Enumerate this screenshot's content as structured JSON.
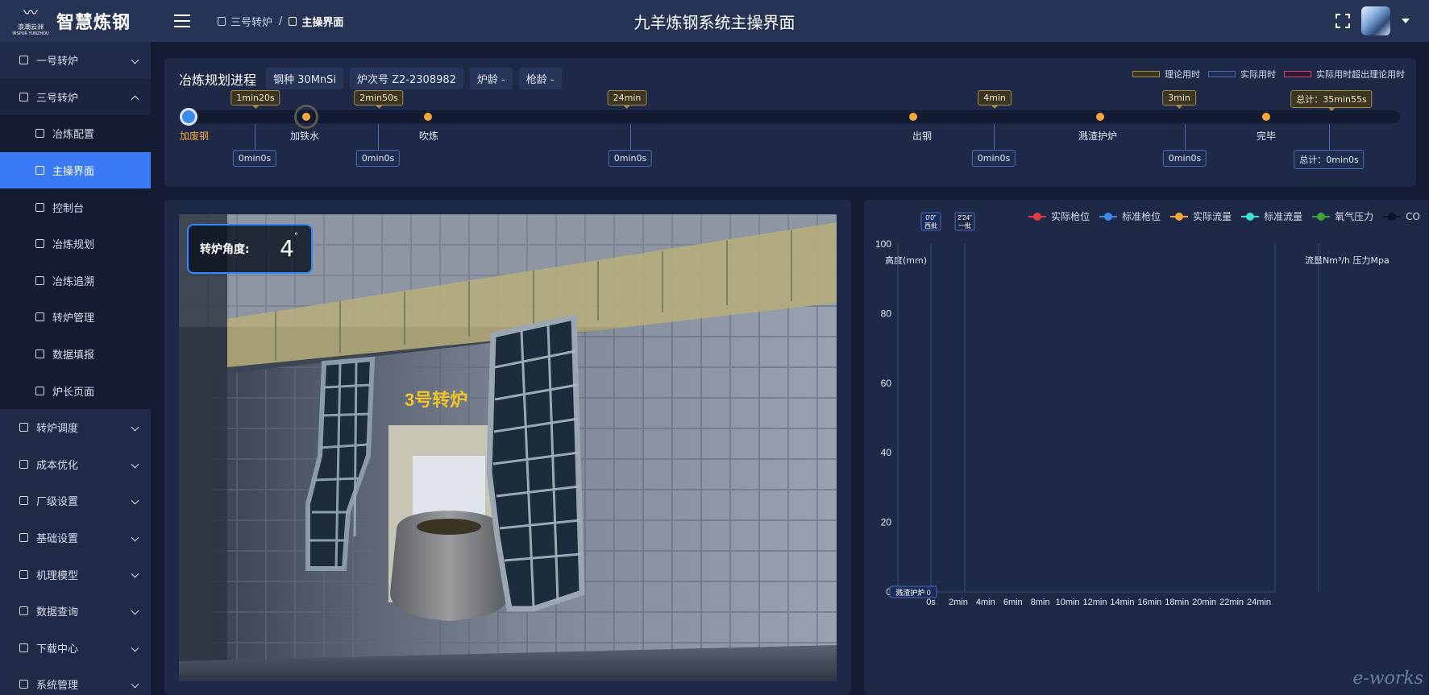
{
  "header": {
    "brand_mark": "浪潮云洲",
    "brand_sub": "INSPUR YUNZHOU",
    "app_title": "智慧炼钢",
    "page_title": "九羊炼钢系统主操界面",
    "breadcrumb": [
      "三号转炉",
      "主操界面"
    ]
  },
  "sidebar": {
    "items": [
      {
        "label": "一号转炉",
        "open": false
      },
      {
        "label": "三号转炉",
        "open": true
      },
      {
        "label": "冶炼配置"
      },
      {
        "label": "主操界面",
        "active": true
      },
      {
        "label": "控制台"
      },
      {
        "label": "冶炼规划"
      },
      {
        "label": "冶炼追溯"
      },
      {
        "label": "转炉管理"
      },
      {
        "label": "数据填报"
      },
      {
        "label": "炉长页面"
      },
      {
        "label": "转炉调度",
        "open": false
      },
      {
        "label": "成本优化",
        "open": false
      },
      {
        "label": "厂级设置",
        "open": false
      },
      {
        "label": "基础设置",
        "open": false
      },
      {
        "label": "机理模型",
        "open": false
      },
      {
        "label": "数据查询",
        "open": false
      },
      {
        "label": "下载中心",
        "open": false
      },
      {
        "label": "系统管理",
        "open": false
      }
    ]
  },
  "progress": {
    "title": "冶炼规划进程",
    "tags": [
      "钢种 30MnSi",
      "炉次号 Z2-2308982",
      "炉龄 -",
      "枪龄 -"
    ],
    "legend": [
      {
        "label": "理论用时",
        "color": "#3b3623",
        "border": "#a58b43"
      },
      {
        "label": "实际用时",
        "color": "#1f2d50",
        "border": "#4c6ab4"
      },
      {
        "label": "实际用时超出理论用时",
        "color": "#2a1d33",
        "border": "#d9406b"
      }
    ],
    "stages": [
      "加废钢",
      "加铁水",
      "吹炼",
      "出钢",
      "溅渣护炉",
      "完毕"
    ],
    "theory_times": [
      "1min20s",
      "2min50s",
      "24min",
      "4min",
      "3min",
      "总计：35min55s"
    ],
    "actual_times": [
      "0min0s",
      "0min0s",
      "0min0s",
      "0min0s",
      "0min0s",
      "总计：0min0s"
    ]
  },
  "scene": {
    "angle_label": "转炉角度:",
    "angle_value": "4",
    "angle_unit": "°",
    "furnace_label": "3号转炉"
  },
  "chart_data": {
    "type": "line",
    "legend": [
      {
        "name": "实际枪位",
        "color": "#e23b3b"
      },
      {
        "name": "标准枪位",
        "color": "#3d8bf0"
      },
      {
        "name": "实际流量",
        "color": "#f5a838"
      },
      {
        "name": "标准流量",
        "color": "#3fe0d0"
      },
      {
        "name": "氧气压力",
        "color": "#3ca23c"
      },
      {
        "name": "CO",
        "color": "#0c1230"
      }
    ],
    "ylabel_left": "高度(mm)",
    "ylabel_right": "流量Nm³/h  压力Mpa",
    "y_ticks": [
      0,
      20,
      40,
      60,
      80,
      100
    ],
    "ylim": [
      0,
      100
    ],
    "x_ticks": [
      "0s",
      "2min",
      "4min",
      "6min",
      "8min",
      "10min",
      "12min",
      "14min",
      "16min",
      "18min",
      "20min",
      "22min",
      "24min"
    ],
    "markers": [
      {
        "time": "0'0\"",
        "label": "西批"
      },
      {
        "time": "2'24\"",
        "label": "一批"
      }
    ],
    "bottom_marker": "溅渣护炉 0",
    "series": []
  },
  "watermark": "e-works"
}
